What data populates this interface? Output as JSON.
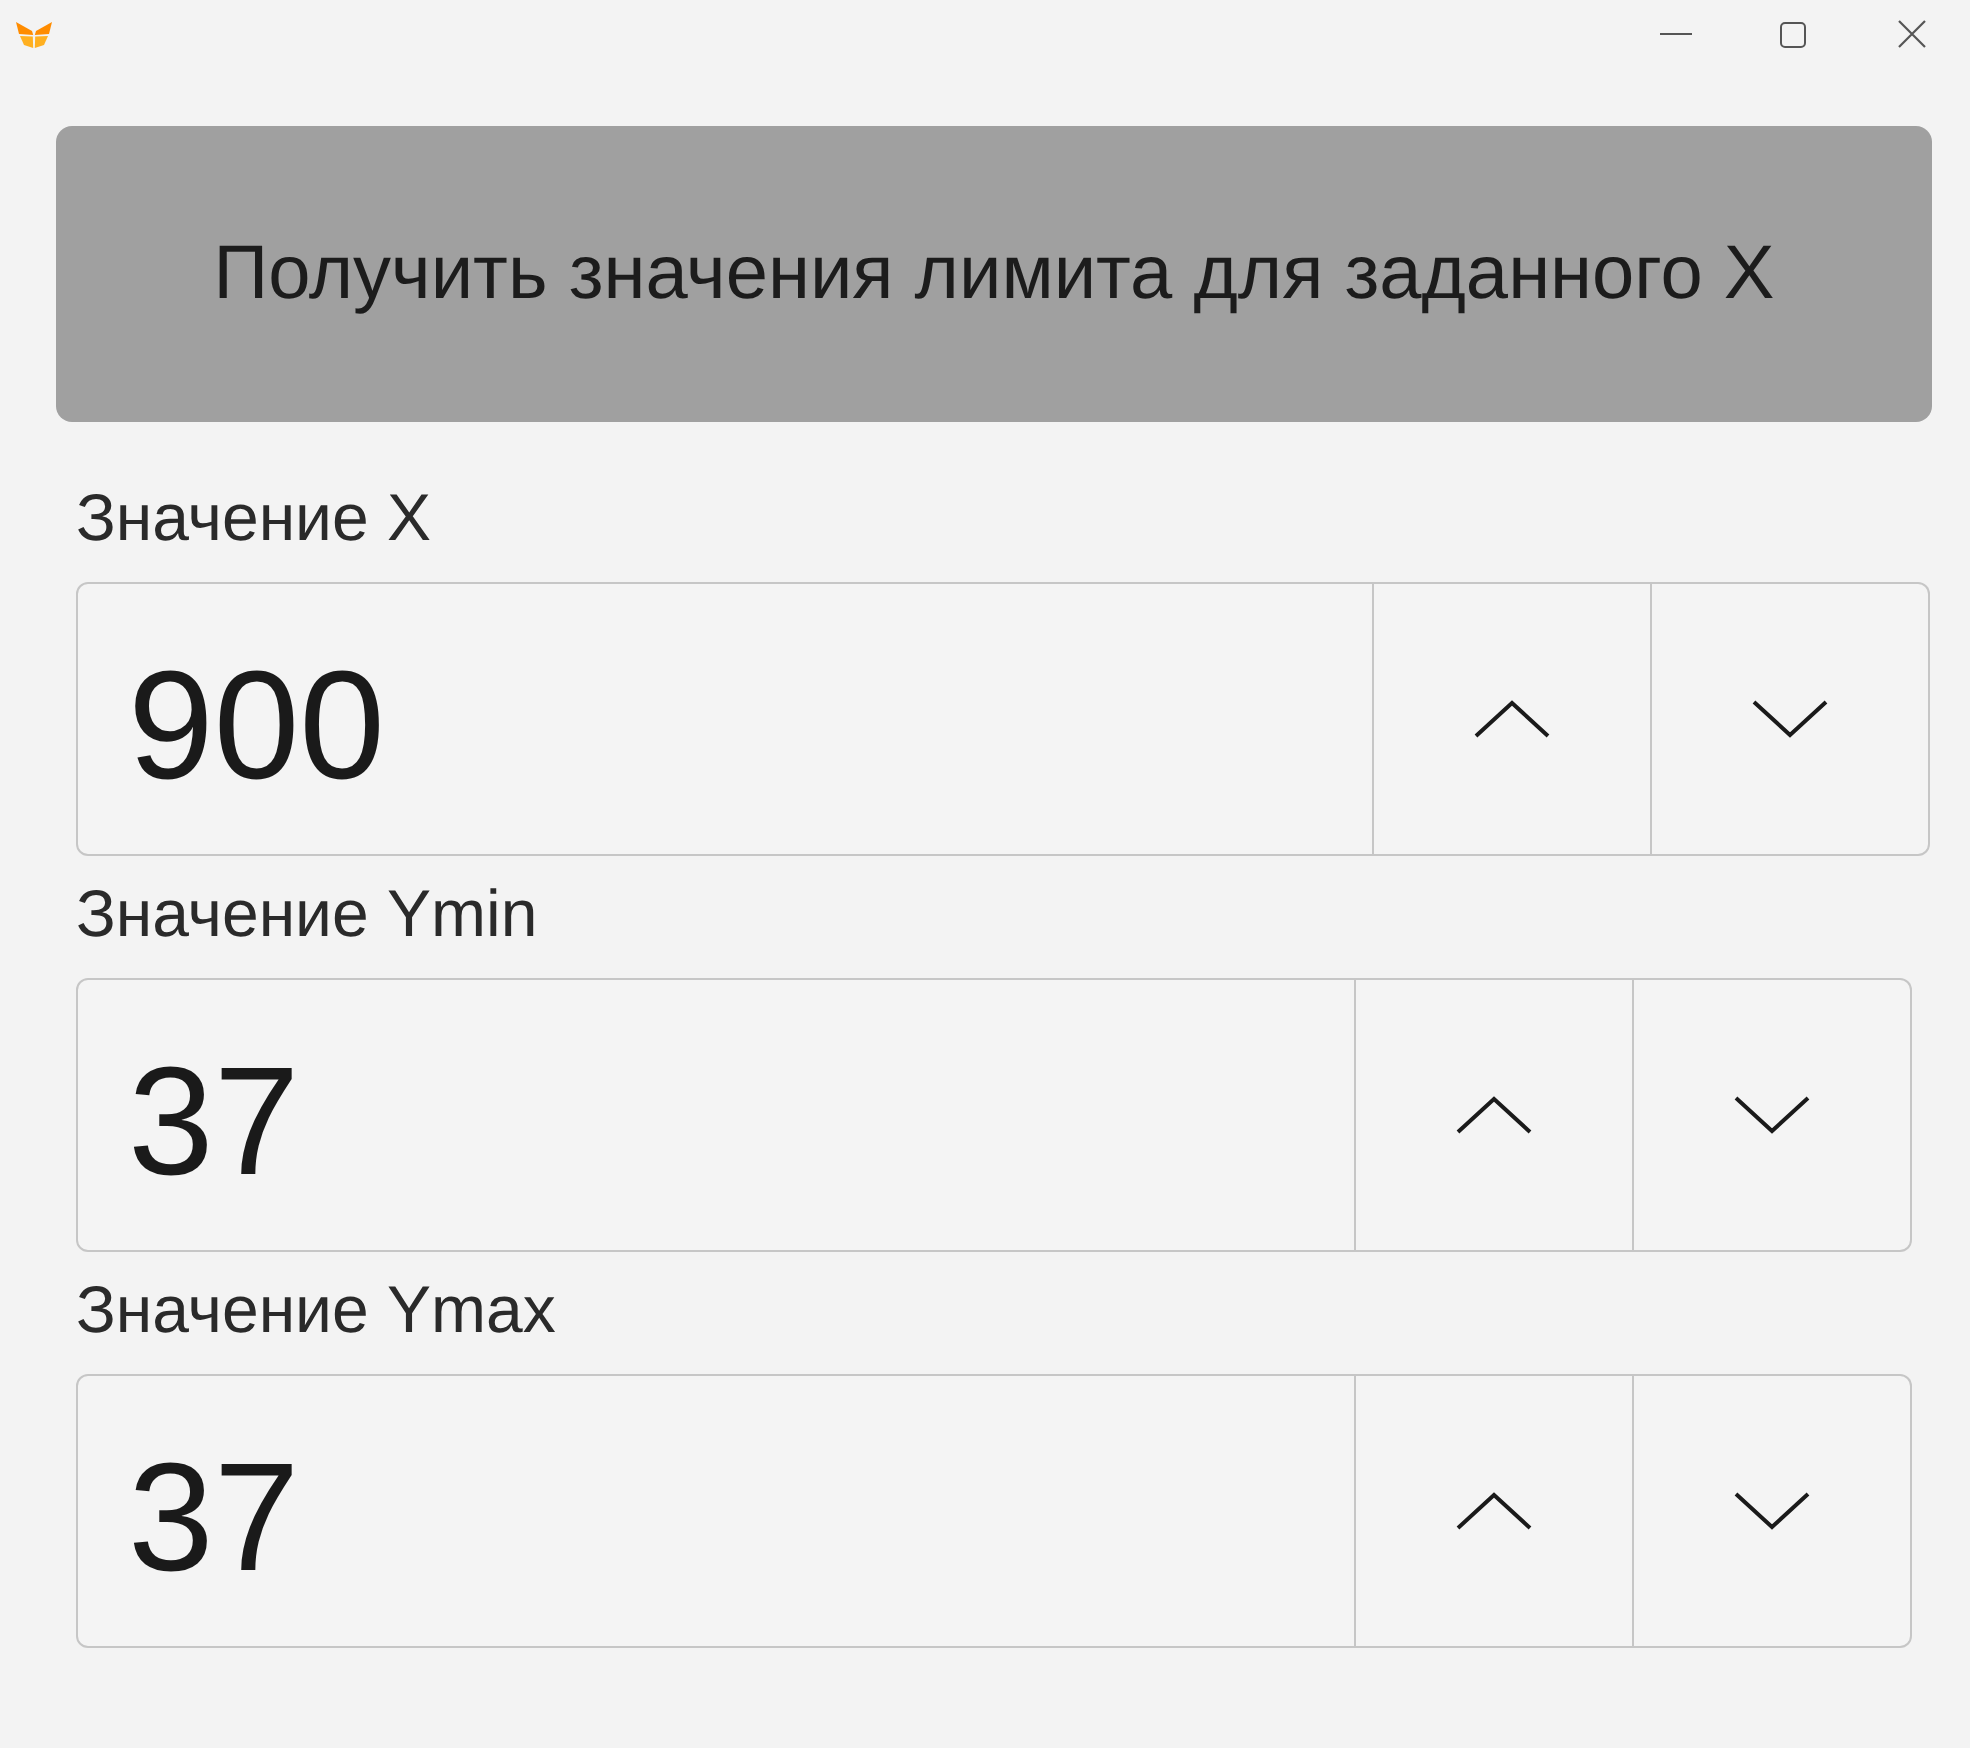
{
  "action_button": {
    "label": "Получить значения лимита для заданного X"
  },
  "fields": [
    {
      "label": "Значение X",
      "value": "900"
    },
    {
      "label": "Значение Ymin",
      "value": "37"
    },
    {
      "label": "Значение Ymax",
      "value": "37"
    }
  ]
}
